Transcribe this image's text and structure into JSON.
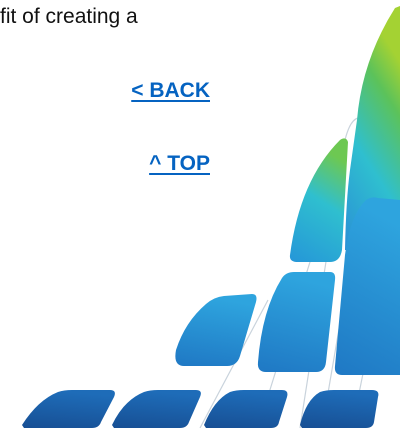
{
  "content": {
    "paragraph_fragment": "fit of creating a"
  },
  "navigation": {
    "back_label": "< BACK",
    "top_label": "^ TOP"
  },
  "decoration": {
    "name": "diagonal-bars-graphic",
    "colors": {
      "blue_dark": "#1a5fa8",
      "blue_mid": "#2a8fd6",
      "cyan": "#2fbfcf",
      "green": "#5cc25a",
      "lime": "#a4d233"
    }
  }
}
